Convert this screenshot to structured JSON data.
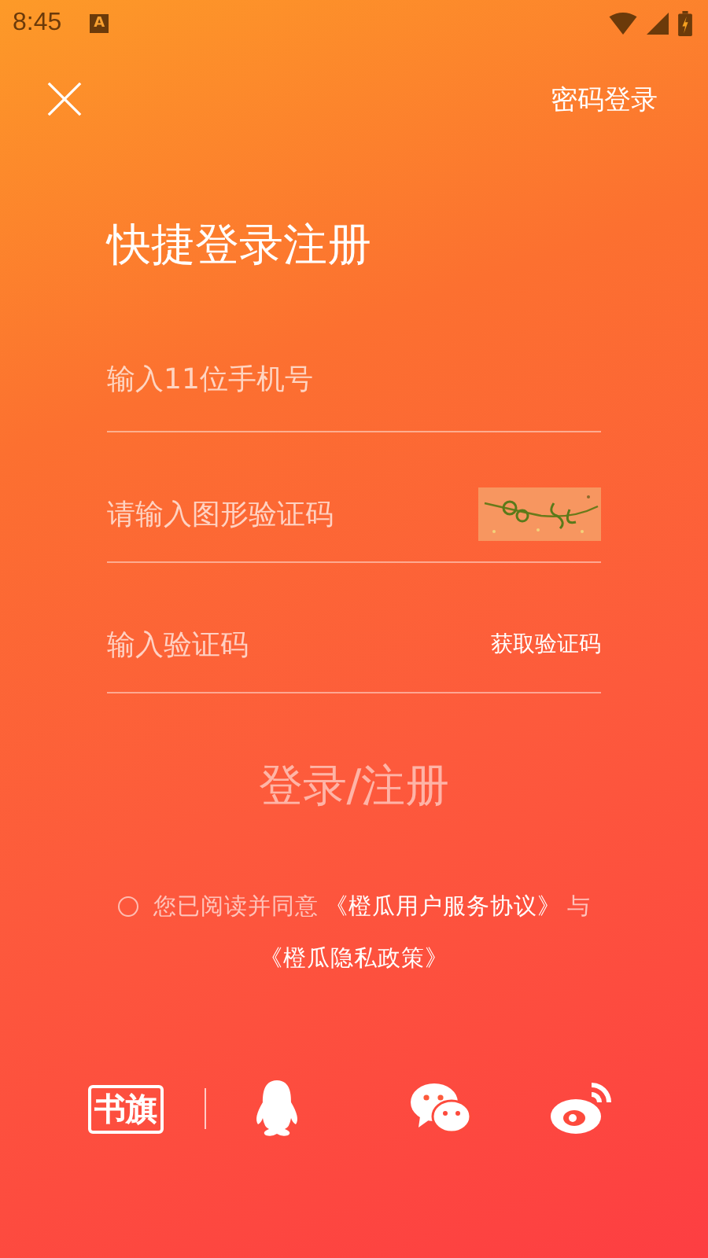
{
  "status_bar": {
    "time": "8:45",
    "notification_badge": "A"
  },
  "top_bar": {
    "password_login": "密码登录"
  },
  "title": "快捷登录注册",
  "fields": [
    {
      "kind": "phone",
      "placeholder": "输入11位手机号"
    },
    {
      "kind": "captcha",
      "placeholder": "请输入图形验证码"
    },
    {
      "kind": "sms",
      "placeholder": "输入验证码",
      "action": "获取验证码"
    }
  ],
  "submit": {
    "label": "登录/注册",
    "disabled": true
  },
  "agreement": {
    "checked": false,
    "text": "您已阅读并同意",
    "terms_link": "《橙瓜用户服务协议》",
    "conjunction": "与",
    "privacy_link": "《橙瓜隐私政策》"
  },
  "third_party": [
    {
      "kind": "shuqi",
      "label": "书旗"
    },
    {
      "kind": "qq"
    },
    {
      "kind": "wechat"
    },
    {
      "kind": "weibo"
    }
  ]
}
